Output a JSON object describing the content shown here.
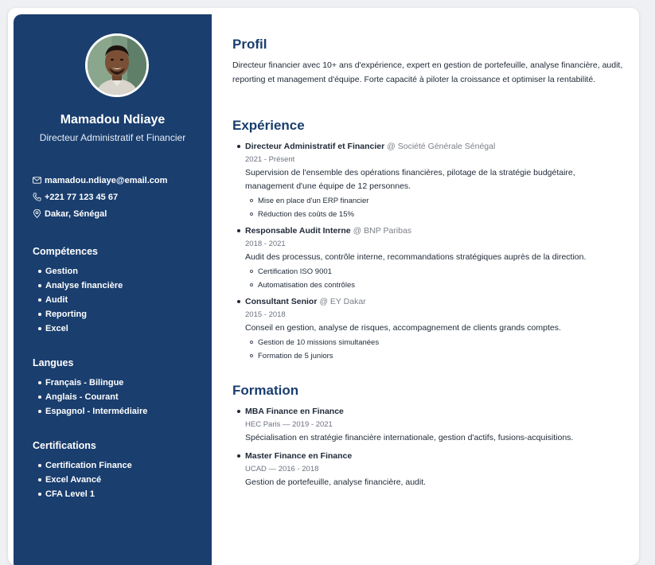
{
  "sidebar": {
    "name": "Mamadou Ndiaye",
    "role": "Directeur Administratif et Financier",
    "contact": {
      "email": "mamadou.ndiaye@email.com",
      "phone": "+221 77 123 45 67",
      "location": "Dakar, Sénégal"
    },
    "skills": {
      "title": "Compétences",
      "items": [
        "Gestion",
        "Analyse financière",
        "Audit",
        "Reporting",
        "Excel"
      ]
    },
    "languages": {
      "title": "Langues",
      "items": [
        "Français - Bilingue",
        "Anglais - Courant",
        "Espagnol - Intermédiaire"
      ]
    },
    "certifications": {
      "title": "Certifications",
      "items": [
        "Certification Finance",
        "Excel Avancé",
        "CFA Level 1"
      ]
    }
  },
  "profile": {
    "title": "Profil",
    "text": "Directeur financier avec 10+ ans d'expérience, expert en gestion de portefeuille, analyse financière, audit, reporting et management d'équipe. Forte capacité à piloter la croissance et optimiser la rentabilité."
  },
  "experience": {
    "title": "Expérience",
    "jobs": [
      {
        "position": "Directeur Administratif et Financier",
        "org": "@ Société Générale Sénégal",
        "dates": "2021 - Présent",
        "description": "Supervision de l'ensemble des opérations financières, pilotage de la stratégie budgétaire, management d'une équipe de 12 personnes.",
        "highlights": [
          "Mise en place d'un ERP financier",
          "Réduction des coûts de 15%"
        ]
      },
      {
        "position": "Responsable Audit Interne",
        "org": "@ BNP Paribas",
        "dates": "2018 - 2021",
        "description": "Audit des processus, contrôle interne, recommandations stratégiques auprès de la direction.",
        "highlights": [
          "Certification ISO 9001",
          "Automatisation des contrôles"
        ]
      },
      {
        "position": "Consultant Senior",
        "org": "@ EY Dakar",
        "dates": "2015 - 2018",
        "description": "Conseil en gestion, analyse de risques, accompagnement de clients grands comptes.",
        "highlights": [
          "Gestion de 10 missions simultanées",
          "Formation de 5 juniors"
        ]
      }
    ]
  },
  "education": {
    "title": "Formation",
    "items": [
      {
        "degree": "MBA Finance en Finance",
        "school": "HEC Paris — 2019 - 2021",
        "description": "Spécialisation en stratégie financière internationale, gestion d'actifs, fusions-acquisitions."
      },
      {
        "degree": "Master Finance en Finance",
        "school": "UCAD — 2016 - 2018",
        "description": "Gestion de portefeuille, analyse financière, audit."
      }
    ]
  },
  "icons": {
    "email": "mail-icon",
    "phone": "phone-icon",
    "location": "map-pin-icon"
  },
  "colors": {
    "sidebar": "#1a3e6e",
    "heading": "#1a3e6e"
  }
}
